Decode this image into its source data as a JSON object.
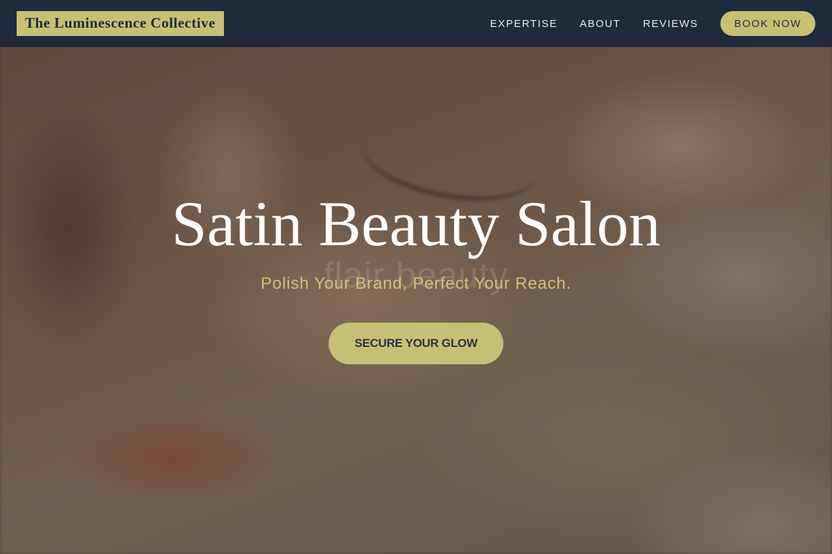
{
  "navbar": {
    "logo": "The Luminescence Collective",
    "links": [
      "EXPERTISE",
      "ABOUT",
      "REVIEWS"
    ],
    "book_label": "BOOK NOW"
  },
  "hero": {
    "title": "Satin Beauty Salon",
    "background_text": "flair beauty",
    "tagline": "Polish Your Brand, Perfect Your Reach.",
    "cta_label": "SECURE YOUR GLOW"
  },
  "colors": {
    "navbar_bg": "#1f2a3c",
    "accent": "#c7bf74",
    "tagline": "#cdc27d",
    "title": "#ffffff"
  }
}
